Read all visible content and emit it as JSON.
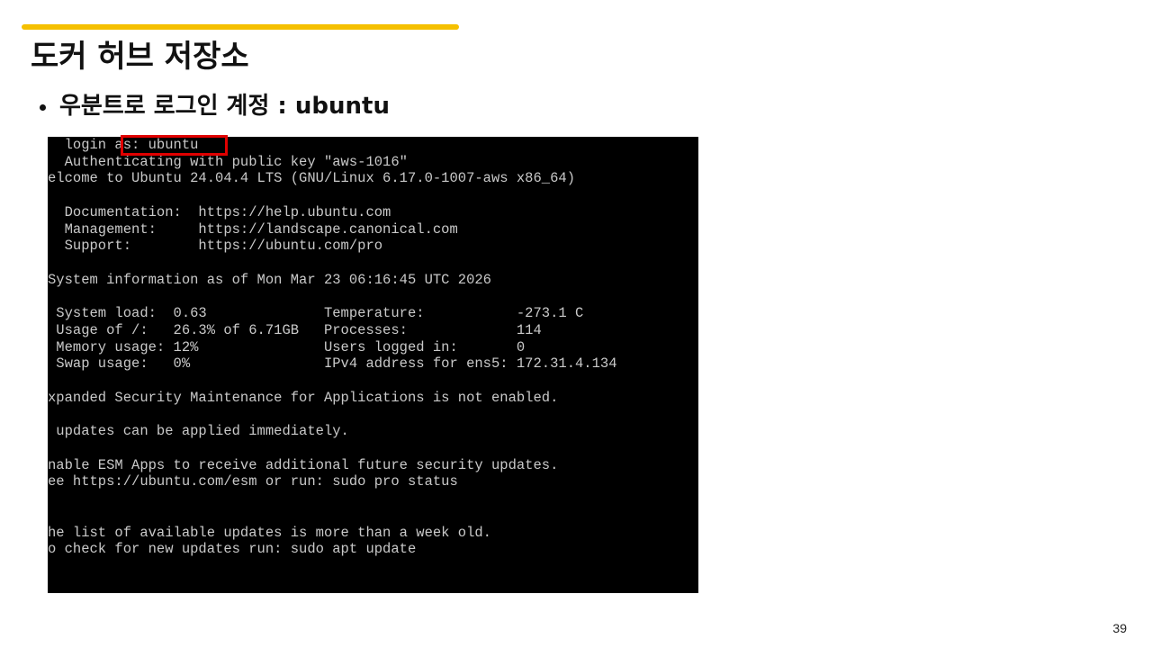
{
  "slide": {
    "title": "도커 허브 저장소",
    "bullet": "우분트로 로그인 계정 : ubuntu",
    "page_number": "39"
  },
  "colors": {
    "accent": "#f5c000",
    "terminal_bg": "#000000",
    "terminal_text": "#c9c9c9",
    "highlight_border": "#e00000"
  },
  "terminal": {
    "highlighted_text": ": ubuntu",
    "lines": [
      "  login as: ubuntu",
      "  Authenticating with public key \"aws-1016\"",
      "elcome to Ubuntu 24.04.4 LTS (GNU/Linux 6.17.0-1007-aws x86_64)",
      "",
      "  Documentation:  https://help.ubuntu.com",
      "  Management:     https://landscape.canonical.com",
      "  Support:        https://ubuntu.com/pro",
      "",
      "System information as of Mon Mar 23 06:16:45 UTC 2026",
      "",
      " System load:  0.63              Temperature:           -273.1 C",
      " Usage of /:   26.3% of 6.71GB   Processes:             114",
      " Memory usage: 12%               Users logged in:       0",
      " Swap usage:   0%                IPv4 address for ens5: 172.31.4.134",
      "",
      "xpanded Security Maintenance for Applications is not enabled.",
      "",
      " updates can be applied immediately.",
      "",
      "nable ESM Apps to receive additional future security updates.",
      "ee https://ubuntu.com/esm or run: sudo pro status",
      "",
      "",
      "he list of available updates is more than a week old.",
      "o check for new updates run: sudo apt update"
    ]
  }
}
